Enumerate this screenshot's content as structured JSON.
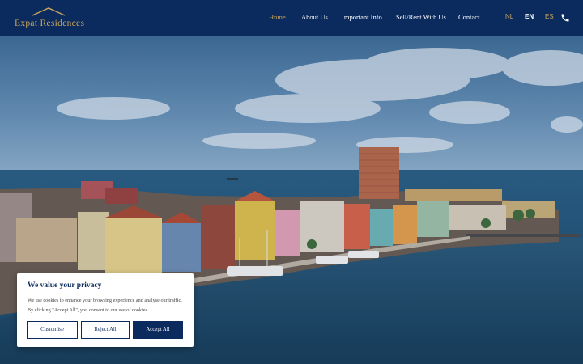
{
  "brand": {
    "name": "Expat Residences",
    "accent_color": "#c9a45c",
    "primary_color": "#0b2b5e"
  },
  "nav": {
    "items": [
      {
        "label": "Home",
        "active": true
      },
      {
        "label": "About Us",
        "active": false
      },
      {
        "label": "Important Info",
        "active": false
      },
      {
        "label": "Sell/Rent With Us",
        "active": false
      },
      {
        "label": "Contact",
        "active": false
      }
    ]
  },
  "languages": [
    {
      "label": "NL",
      "active": false
    },
    {
      "label": "EN",
      "active": true
    },
    {
      "label": "ES",
      "active": false
    }
  ],
  "header_icons": [
    "phone-icon"
  ],
  "hero": {
    "image": "harbour-city-panorama"
  },
  "cookie_banner": {
    "title": "We value your privacy",
    "text": "We use cookies to enhance your browsing experience and analyse our traffic. By clicking \"Accept All\", you consent to our use of cookies.",
    "buttons": {
      "customise": "Customise",
      "reject": "Reject All",
      "accept": "Accept All"
    }
  }
}
